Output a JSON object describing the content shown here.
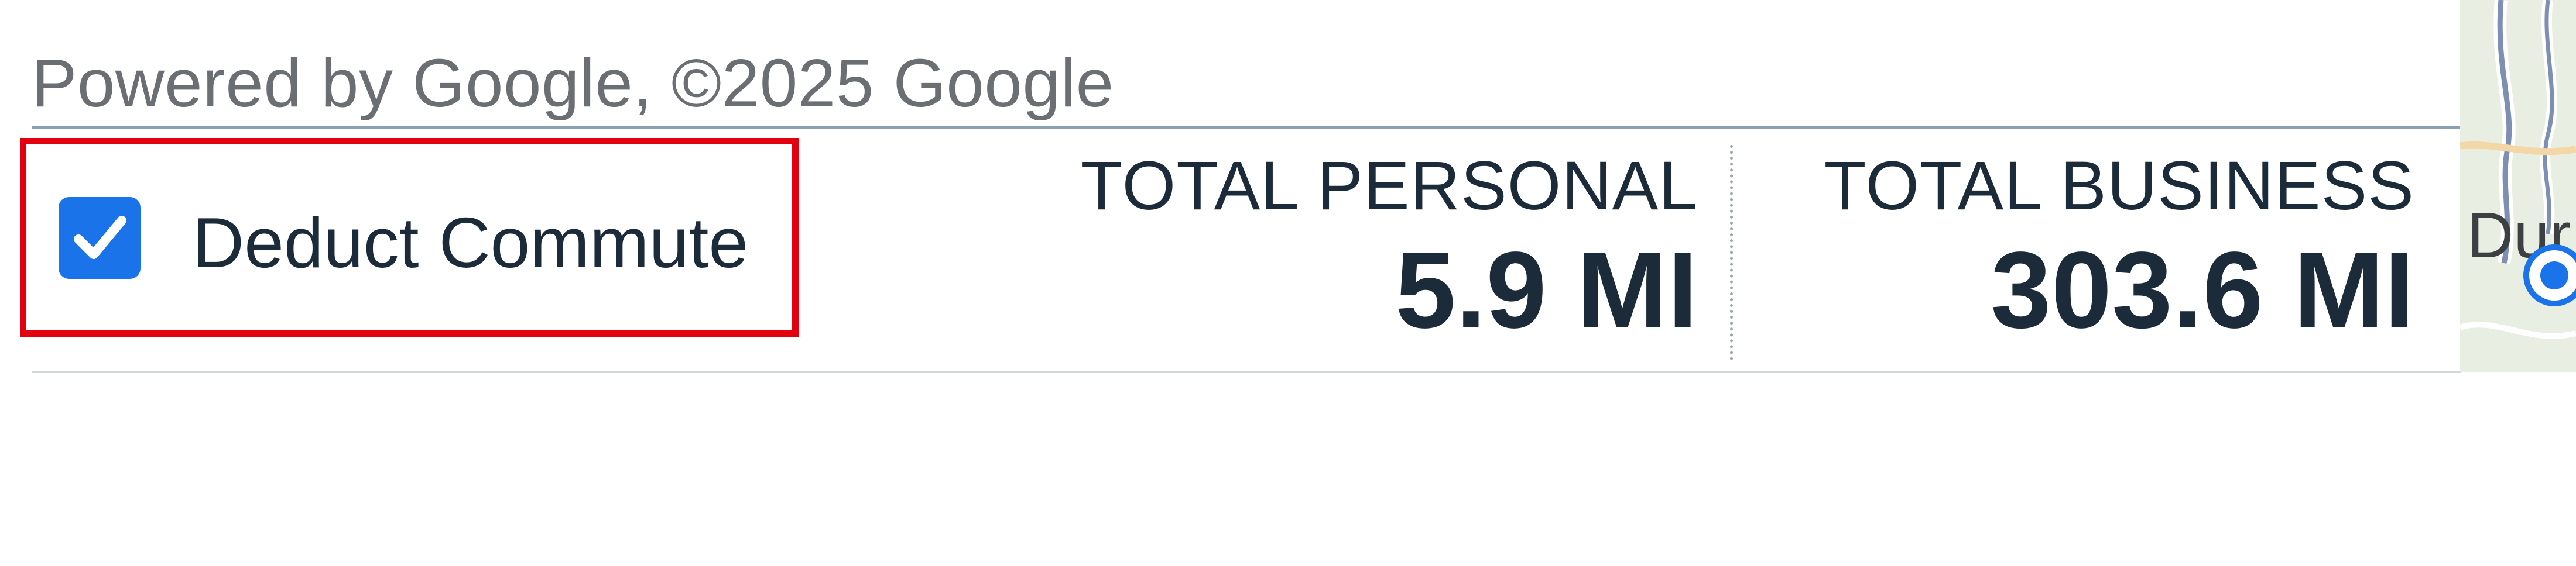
{
  "attribution": {
    "text": "Powered by Google, ©2025 Google"
  },
  "commute": {
    "label": "Deduct Commute",
    "checked": true,
    "highlight_color": "#e3000f",
    "checkbox_color": "#1a73e8",
    "checkbox_icon": "checkmark-icon"
  },
  "totals": {
    "personal": {
      "label": "TOTAL PERSONAL",
      "value": "5.9 MI"
    },
    "business": {
      "label": "TOTAL BUSINESS",
      "value": "303.6 MI"
    }
  },
  "map": {
    "place_label": "Dur",
    "marker_icon": "google-location-marker-icon"
  },
  "colors": {
    "text_primary": "#1c2b3a",
    "text_secondary": "#6b6f73",
    "accent": "#1a73e8"
  }
}
